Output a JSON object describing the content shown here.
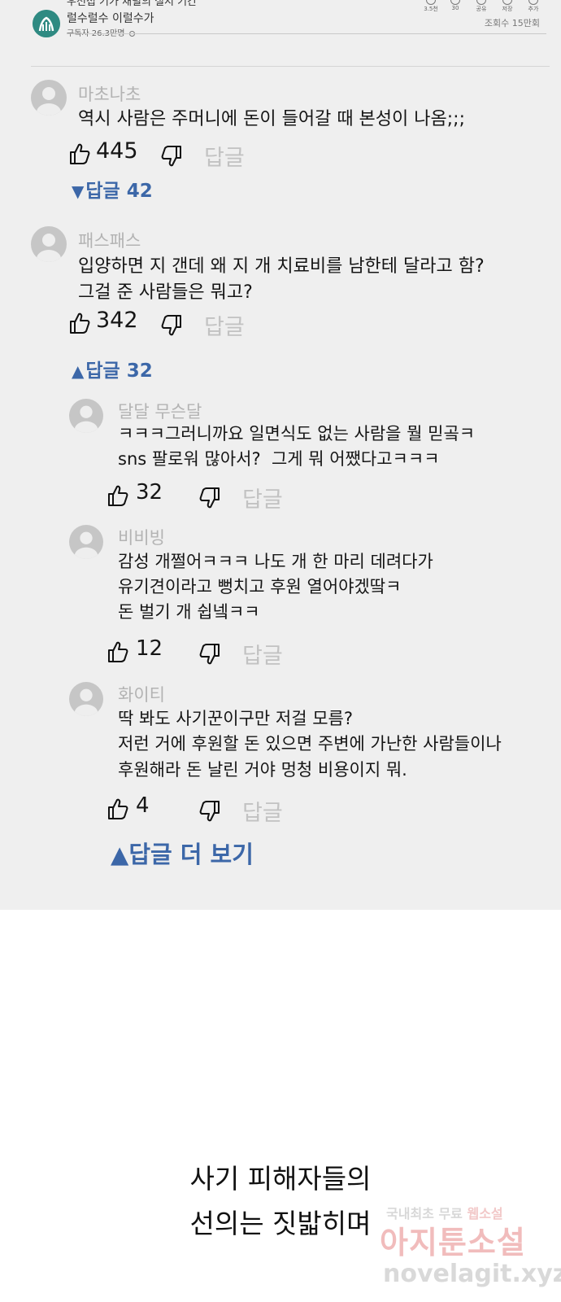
{
  "header": {
    "cut_title": "우선접 기가 채널의 실시 기간",
    "channel_name": "럴수럴수 이럴수가",
    "subscribers": "구독자 26.3만명",
    "views": "조회수 15만회",
    "actions": [
      {
        "label": "3.5천"
      },
      {
        "label": "30"
      },
      {
        "label": "공유"
      },
      {
        "label": "저장"
      },
      {
        "label": "추가"
      }
    ]
  },
  "comments": [
    {
      "user": "마초나초",
      "lines": [
        "역시 사람은 주머니에 돈이 들어갈 때 본성이 나옴;;;"
      ],
      "likes": "445",
      "reply_label": "답글",
      "replies_toggle": "답글 42"
    },
    {
      "user": "패스패스",
      "lines": [
        "입양하면 지 갠데 왜 지 개 치료비를 남한테 달라고 함?",
        "그걸 준 사람들은 뭐고?"
      ],
      "likes": "342",
      "reply_label": "답글",
      "replies_toggle": "답글 32"
    }
  ],
  "replies": [
    {
      "user": "달달 무슨달",
      "lines": [
        "ㅋㅋㅋ그러니까요 일면식도 없는 사람을 뭘 믿곸ㅋ",
        "sns 팔로워 많아서?  그게 뭐 어쨌다고ㅋㅋㅋ"
      ],
      "likes": "32",
      "reply_label": "답글"
    },
    {
      "user": "비비빙",
      "lines": [
        "감성 개쩔어ㅋㅋㅋ 나도 개 한 마리 데려다가",
        "유기견이라고 뻥치고 후원 열어야겠땈ㅋ",
        "돈 벌기 개 쉽넼ㅋㅋ"
      ],
      "likes": "12",
      "reply_label": "답글"
    },
    {
      "user": "화이티",
      "lines": [
        "딱 봐도 사기꾼이구만 저걸 모름?",
        "저런 거에 후원할 돈 있으면 주변에 가난한 사람들이나",
        "후원해라 돈 날린 거야 멍청 비용이지 뭐."
      ],
      "likes": "4",
      "reply_label": "답글"
    }
  ],
  "more_replies": "답글 더 보기",
  "caption": [
    "사기 피해자들의",
    "선의는 짓밟히며"
  ],
  "watermark": {
    "line1_a": "국내최초 무료",
    "line1_b": "웹소설",
    "line2": "아지툰소설",
    "line3": "novelagit.xyz"
  }
}
